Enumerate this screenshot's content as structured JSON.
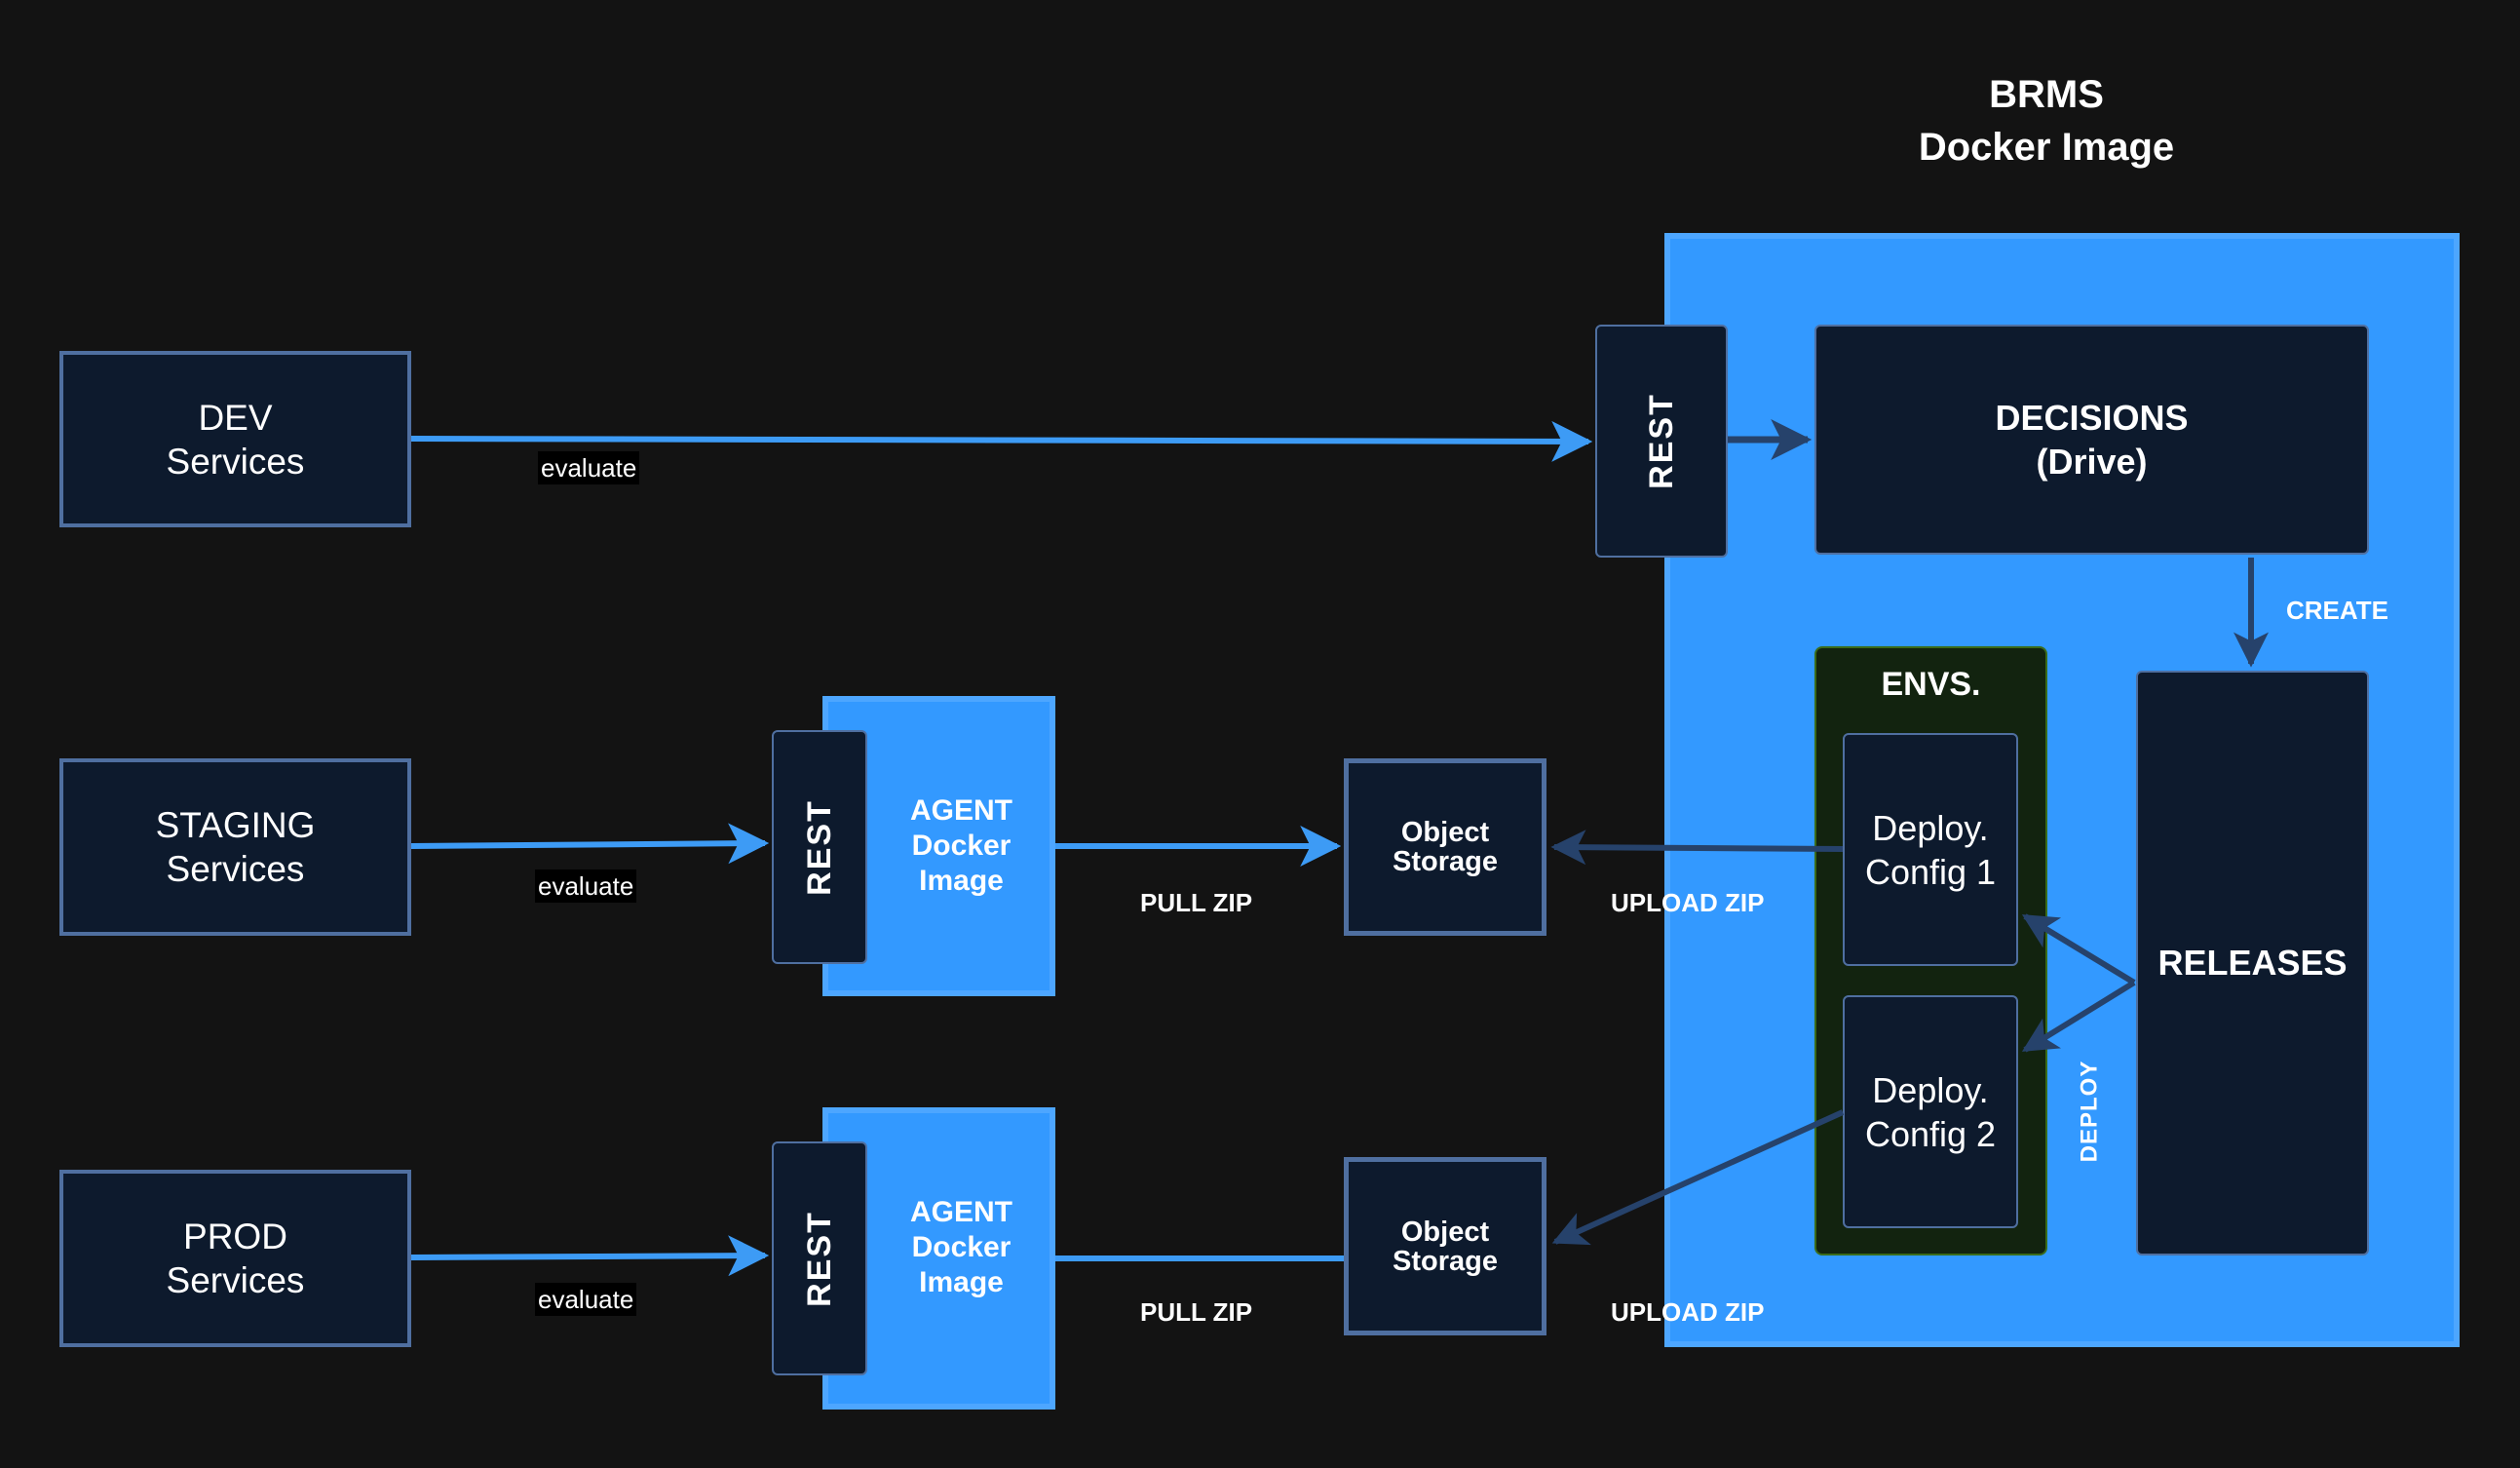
{
  "title": {
    "line1": "BRMS",
    "line2": "Docker Image"
  },
  "services": [
    {
      "line1": "DEV",
      "line2": "Services",
      "edge_label": "evaluate"
    },
    {
      "line1": "STAGING",
      "line2": "Services",
      "edge_label": "evaluate"
    },
    {
      "line1": "PROD",
      "line2": "Services",
      "edge_label": "evaluate"
    }
  ],
  "agents": [
    {
      "rest": "REST",
      "line1": "AGENT",
      "line2": "Docker",
      "line3": "Image",
      "edge_label": "PULL ZIP"
    },
    {
      "rest": "REST",
      "line1": "AGENT",
      "line2": "Docker",
      "line3": "Image",
      "edge_label": "PULL ZIP"
    }
  ],
  "storage": [
    {
      "line1": "Object",
      "line2": "Storage",
      "edge_label": "UPLOAD ZIP"
    },
    {
      "line1": "Object",
      "line2": "Storage",
      "edge_label": "UPLOAD ZIP"
    }
  ],
  "brms": {
    "rest": "REST",
    "decisions": {
      "line1": "DECISIONS",
      "line2": "(Drive)"
    },
    "create_label": "CREATE",
    "envs": {
      "title": "ENVS.",
      "configs": [
        {
          "line1": "Deploy.",
          "line2": "Config 1"
        },
        {
          "line1": "Deploy.",
          "line2": "Config 2"
        }
      ]
    },
    "releases": "RELEASES",
    "deploy_label": "DEPLOY"
  },
  "colors": {
    "background": "#131313",
    "container_blue": "#3399ff",
    "node_dark": "#0d1a2d",
    "node_border": "#4f6fa0",
    "envs_green": "#12230f",
    "arrow_light": "#3d9bf5",
    "arrow_dark": "#26426b"
  }
}
